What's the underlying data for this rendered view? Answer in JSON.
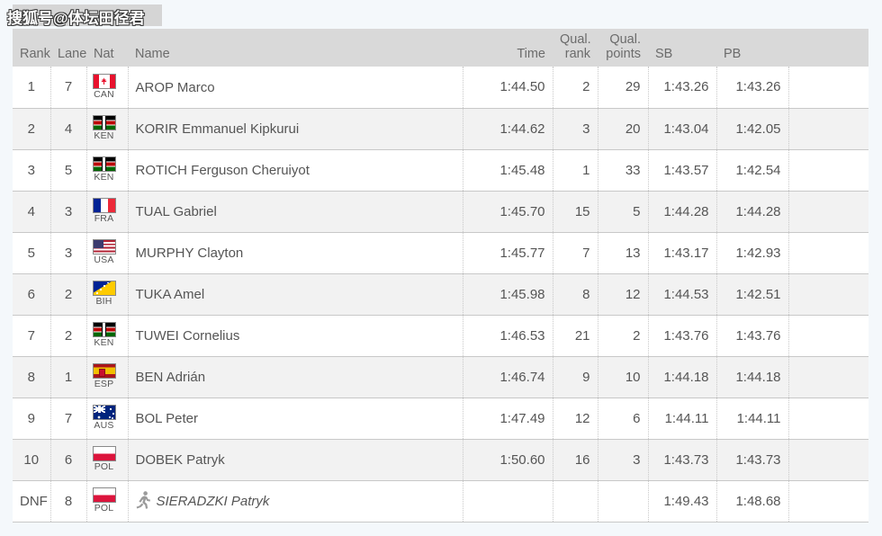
{
  "watermark": {
    "text": "搜狐号@体坛田径君"
  },
  "table": {
    "headers": {
      "rank": "Rank",
      "lane": "Lane",
      "nat": "Nat",
      "name": "Name",
      "time": "Time",
      "qual_rank_line1": "Qual.",
      "qual_rank_line2": "rank",
      "qual_points_line1": "Qual.",
      "qual_points_line2": "points",
      "sb": "SB",
      "pb": "PB",
      "blank": ""
    },
    "rows": [
      {
        "rank": "1",
        "lane": "7",
        "nat": "CAN",
        "name": "AROP Marco",
        "time": "1:44.50",
        "qual_rank": "2",
        "qual_points": "29",
        "sb": "1:43.26",
        "pb": "1:43.26",
        "dnf": false
      },
      {
        "rank": "2",
        "lane": "4",
        "nat": "KEN",
        "name": "KORIR Emmanuel Kipkurui",
        "time": "1:44.62",
        "qual_rank": "3",
        "qual_points": "20",
        "sb": "1:43.04",
        "pb": "1:42.05",
        "dnf": false
      },
      {
        "rank": "3",
        "lane": "5",
        "nat": "KEN",
        "name": "ROTICH Ferguson Cheruiyot",
        "time": "1:45.48",
        "qual_rank": "1",
        "qual_points": "33",
        "sb": "1:43.57",
        "pb": "1:42.54",
        "dnf": false
      },
      {
        "rank": "4",
        "lane": "3",
        "nat": "FRA",
        "name": "TUAL Gabriel",
        "time": "1:45.70",
        "qual_rank": "15",
        "qual_points": "5",
        "sb": "1:44.28",
        "pb": "1:44.28",
        "dnf": false
      },
      {
        "rank": "5",
        "lane": "3",
        "nat": "USA",
        "name": "MURPHY Clayton",
        "time": "1:45.77",
        "qual_rank": "7",
        "qual_points": "13",
        "sb": "1:43.17",
        "pb": "1:42.93",
        "dnf": false
      },
      {
        "rank": "6",
        "lane": "2",
        "nat": "BIH",
        "name": "TUKA Amel",
        "time": "1:45.98",
        "qual_rank": "8",
        "qual_points": "12",
        "sb": "1:44.53",
        "pb": "1:42.51",
        "dnf": false
      },
      {
        "rank": "7",
        "lane": "2",
        "nat": "KEN",
        "name": "TUWEI Cornelius",
        "time": "1:46.53",
        "qual_rank": "21",
        "qual_points": "2",
        "sb": "1:43.76",
        "pb": "1:43.76",
        "dnf": false
      },
      {
        "rank": "8",
        "lane": "1",
        "nat": "ESP",
        "name": "BEN Adrián",
        "time": "1:46.74",
        "qual_rank": "9",
        "qual_points": "10",
        "sb": "1:44.18",
        "pb": "1:44.18",
        "dnf": false
      },
      {
        "rank": "9",
        "lane": "7",
        "nat": "AUS",
        "name": "BOL Peter",
        "time": "1:47.49",
        "qual_rank": "12",
        "qual_points": "6",
        "sb": "1:44.11",
        "pb": "1:44.11",
        "dnf": false
      },
      {
        "rank": "10",
        "lane": "6",
        "nat": "POL",
        "name": "DOBEK Patryk",
        "time": "1:50.60",
        "qual_rank": "16",
        "qual_points": "3",
        "sb": "1:43.73",
        "pb": "1:43.73",
        "dnf": false
      },
      {
        "rank": "DNF",
        "lane": "8",
        "nat": "POL",
        "name": "SIERADZKI Patryk",
        "time": "",
        "qual_rank": "",
        "qual_points": "",
        "sb": "1:49.43",
        "pb": "1:48.68",
        "dnf": true
      }
    ]
  },
  "colors": {
    "page_bg": "#f4f8fb",
    "header_bg": "#d9d9d9",
    "row_odd_bg": "#ffffff",
    "row_even_bg": "#f2f2f2",
    "name_text": "#2f2f6e",
    "body_text": "#555555",
    "header_text": "#6b6b6b"
  }
}
